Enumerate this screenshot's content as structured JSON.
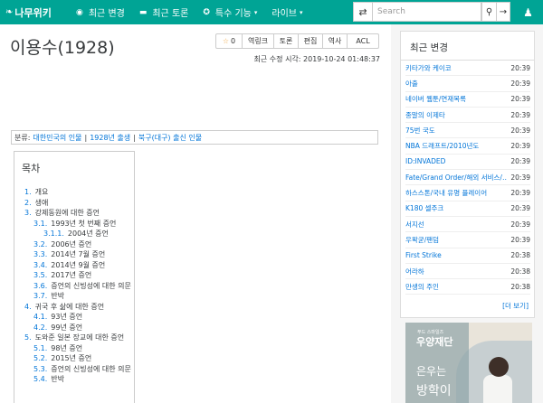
{
  "navbar": {
    "logo": "나무위키",
    "items": [
      {
        "icon": "compass-icon",
        "glyph": "◉",
        "label": "최근 변경"
      },
      {
        "icon": "comment-icon",
        "glyph": "▬",
        "label": "최근 토론"
      },
      {
        "icon": "cog-icon",
        "glyph": "✪",
        "label": "특수 기능",
        "caret": "▾"
      },
      {
        "icon": "none",
        "glyph": "",
        "label": "라이브",
        "caret": "▾"
      }
    ],
    "search_placeholder": "Search"
  },
  "article": {
    "title": "이용수(1928)",
    "tools": {
      "star_count": "0",
      "backlinks": "역링크",
      "discuss": "토론",
      "edit": "편집",
      "history": "역사",
      "acl": "ACL"
    },
    "last_modified": "최근 수정 시각: 2019-10-24 01:48:37",
    "categories_label": "분류:",
    "categories": [
      "대한민국의 인물",
      "1928년 출생",
      "북구(대구) 출신 인물"
    ],
    "toc_title": "목차",
    "toc": [
      {
        "num": "1.",
        "label": "개요",
        "level": 1
      },
      {
        "num": "2.",
        "label": "생애",
        "level": 1
      },
      {
        "num": "3.",
        "label": "강제동원에 대한 증언",
        "level": 1
      },
      {
        "num": "3.1.",
        "label": "1993년 첫 번째 증언",
        "level": 2
      },
      {
        "num": "3.1.1.",
        "label": "2004년 증언",
        "level": 3
      },
      {
        "num": "3.2.",
        "label": "2006년 증언",
        "level": 2
      },
      {
        "num": "3.3.",
        "label": "2014년 7월 증언",
        "level": 2
      },
      {
        "num": "3.4.",
        "label": "2014년 9월 증언",
        "level": 2
      },
      {
        "num": "3.5.",
        "label": "2017년 증언",
        "level": 2
      },
      {
        "num": "3.6.",
        "label": "증언의 신빙성에 대한 의문",
        "level": 2
      },
      {
        "num": "3.7.",
        "label": "반박",
        "level": 2
      },
      {
        "num": "4.",
        "label": "귀국 후 삶에 대한 증언",
        "level": 1
      },
      {
        "num": "4.1.",
        "label": "93년 증언",
        "level": 2
      },
      {
        "num": "4.2.",
        "label": "99년 증언",
        "level": 2
      },
      {
        "num": "5.",
        "label": "도와준 일본 장교에 대한 증언",
        "level": 1
      },
      {
        "num": "5.1.",
        "label": "98년 증언",
        "level": 2
      },
      {
        "num": "5.2.",
        "label": "2015년 증언",
        "level": 2
      },
      {
        "num": "5.3.",
        "label": "증언의 신빙성에 대한 의문",
        "level": 2
      },
      {
        "num": "5.4.",
        "label": "반박",
        "level": 2
      }
    ]
  },
  "sidebar": {
    "title": "최근 변경",
    "items": [
      {
        "doc": "키타가와 케이코",
        "time": "20:39"
      },
      {
        "doc": "아출",
        "time": "20:39"
      },
      {
        "doc": "네이버 웹툰/연재목록",
        "time": "20:39"
      },
      {
        "doc": "종말의 이제타",
        "time": "20:39"
      },
      {
        "doc": "75번 국도",
        "time": "20:39"
      },
      {
        "doc": "NBA 드래프트/2010년도",
        "time": "20:39"
      },
      {
        "doc": "ID:INVADED",
        "time": "20:39"
      },
      {
        "doc": "Fate/Grand Order/해외 서비스/…",
        "time": "20:39"
      },
      {
        "doc": "하스스톤/국내 유명 플레이어",
        "time": "20:39"
      },
      {
        "doc": "K180 셀주크",
        "time": "20:39"
      },
      {
        "doc": "서지선",
        "time": "20:39"
      },
      {
        "doc": "우왁굳/팬덤",
        "time": "20:39"
      },
      {
        "doc": "First Strike",
        "time": "20:38"
      },
      {
        "doc": "어라하",
        "time": "20:38"
      },
      {
        "doc": "만생의 주인",
        "time": "20:38"
      }
    ],
    "more": "[더 보기]"
  },
  "ad": {
    "sub": "푸드 스마일즈",
    "brand": "우양재단",
    "line1": "은우는",
    "line2": "방학이"
  }
}
